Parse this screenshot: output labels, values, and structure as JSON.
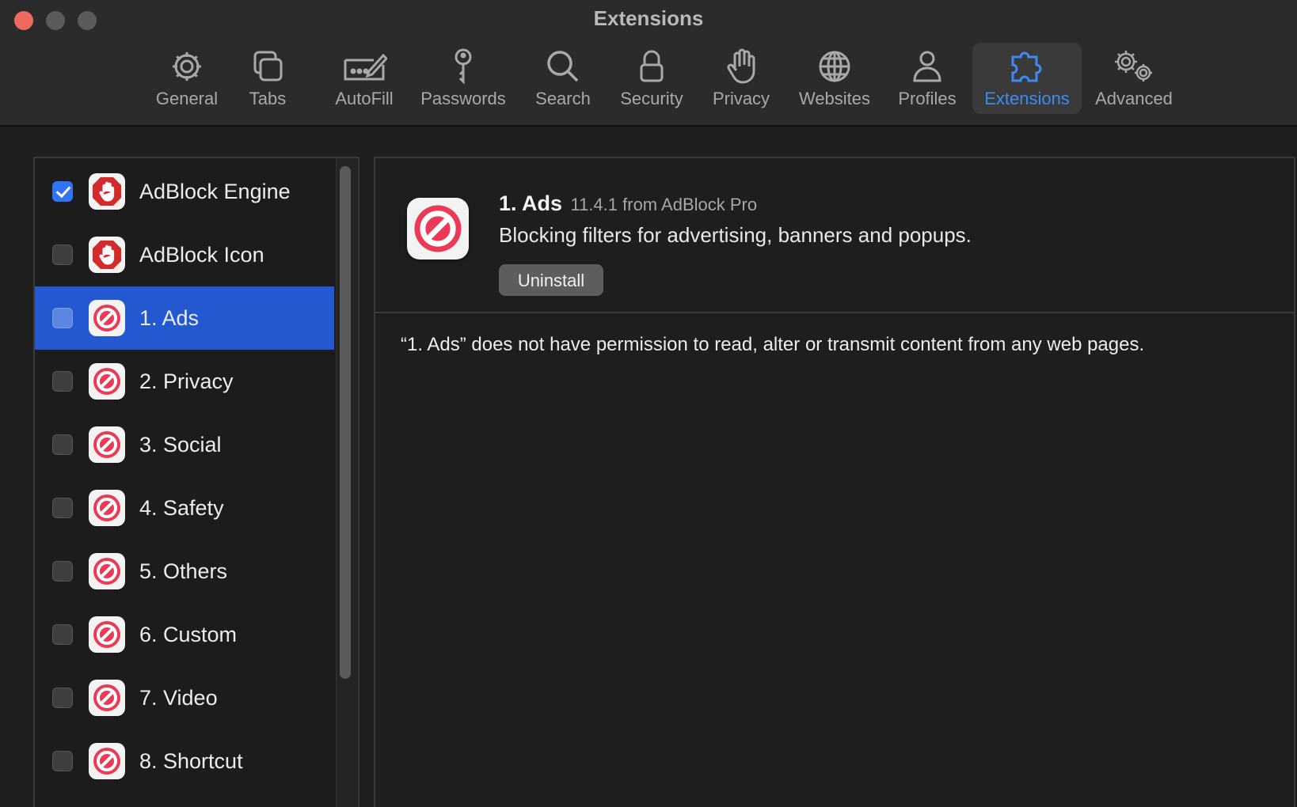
{
  "window": {
    "title": "Extensions"
  },
  "toolbar": {
    "items": [
      {
        "label": "General",
        "icon": "gear-icon"
      },
      {
        "label": "Tabs",
        "icon": "tabs-icon"
      },
      {
        "label": "AutoFill",
        "icon": "autofill-icon"
      },
      {
        "label": "Passwords",
        "icon": "key-icon"
      },
      {
        "label": "Search",
        "icon": "search-icon"
      },
      {
        "label": "Security",
        "icon": "lock-icon"
      },
      {
        "label": "Privacy",
        "icon": "hand-icon"
      },
      {
        "label": "Websites",
        "icon": "globe-icon"
      },
      {
        "label": "Profiles",
        "icon": "person-icon"
      },
      {
        "label": "Extensions",
        "icon": "puzzle-icon",
        "active": true
      },
      {
        "label": "Advanced",
        "icon": "gears-icon"
      }
    ]
  },
  "sidebar": {
    "items": [
      {
        "name": "AdBlock Engine",
        "checked": true,
        "icon": "adblock-hand-icon"
      },
      {
        "name": "AdBlock Icon",
        "checked": false,
        "icon": "adblock-hand-icon"
      },
      {
        "name": "1. Ads",
        "checked": false,
        "icon": "block-icon",
        "selected": true
      },
      {
        "name": "2. Privacy",
        "checked": false,
        "icon": "block-icon"
      },
      {
        "name": "3. Social",
        "checked": false,
        "icon": "block-icon"
      },
      {
        "name": "4. Safety",
        "checked": false,
        "icon": "block-icon"
      },
      {
        "name": "5. Others",
        "checked": false,
        "icon": "block-icon"
      },
      {
        "name": "6. Custom",
        "checked": false,
        "icon": "block-icon"
      },
      {
        "name": "7. Video",
        "checked": false,
        "icon": "block-icon"
      },
      {
        "name": "8. Shortcut",
        "checked": false,
        "icon": "block-icon"
      }
    ]
  },
  "detail": {
    "name": "1. Ads",
    "meta": "11.4.1 from AdBlock Pro",
    "description": "Blocking filters for advertising, banners and popups.",
    "uninstall_label": "Uninstall",
    "permission_text": "“1. Ads” does not have permission to read, alter or transmit content from any web pages."
  },
  "colors": {
    "accent": "#3d8bf2",
    "selection": "#2458d1",
    "close": "#ed6a5e"
  }
}
